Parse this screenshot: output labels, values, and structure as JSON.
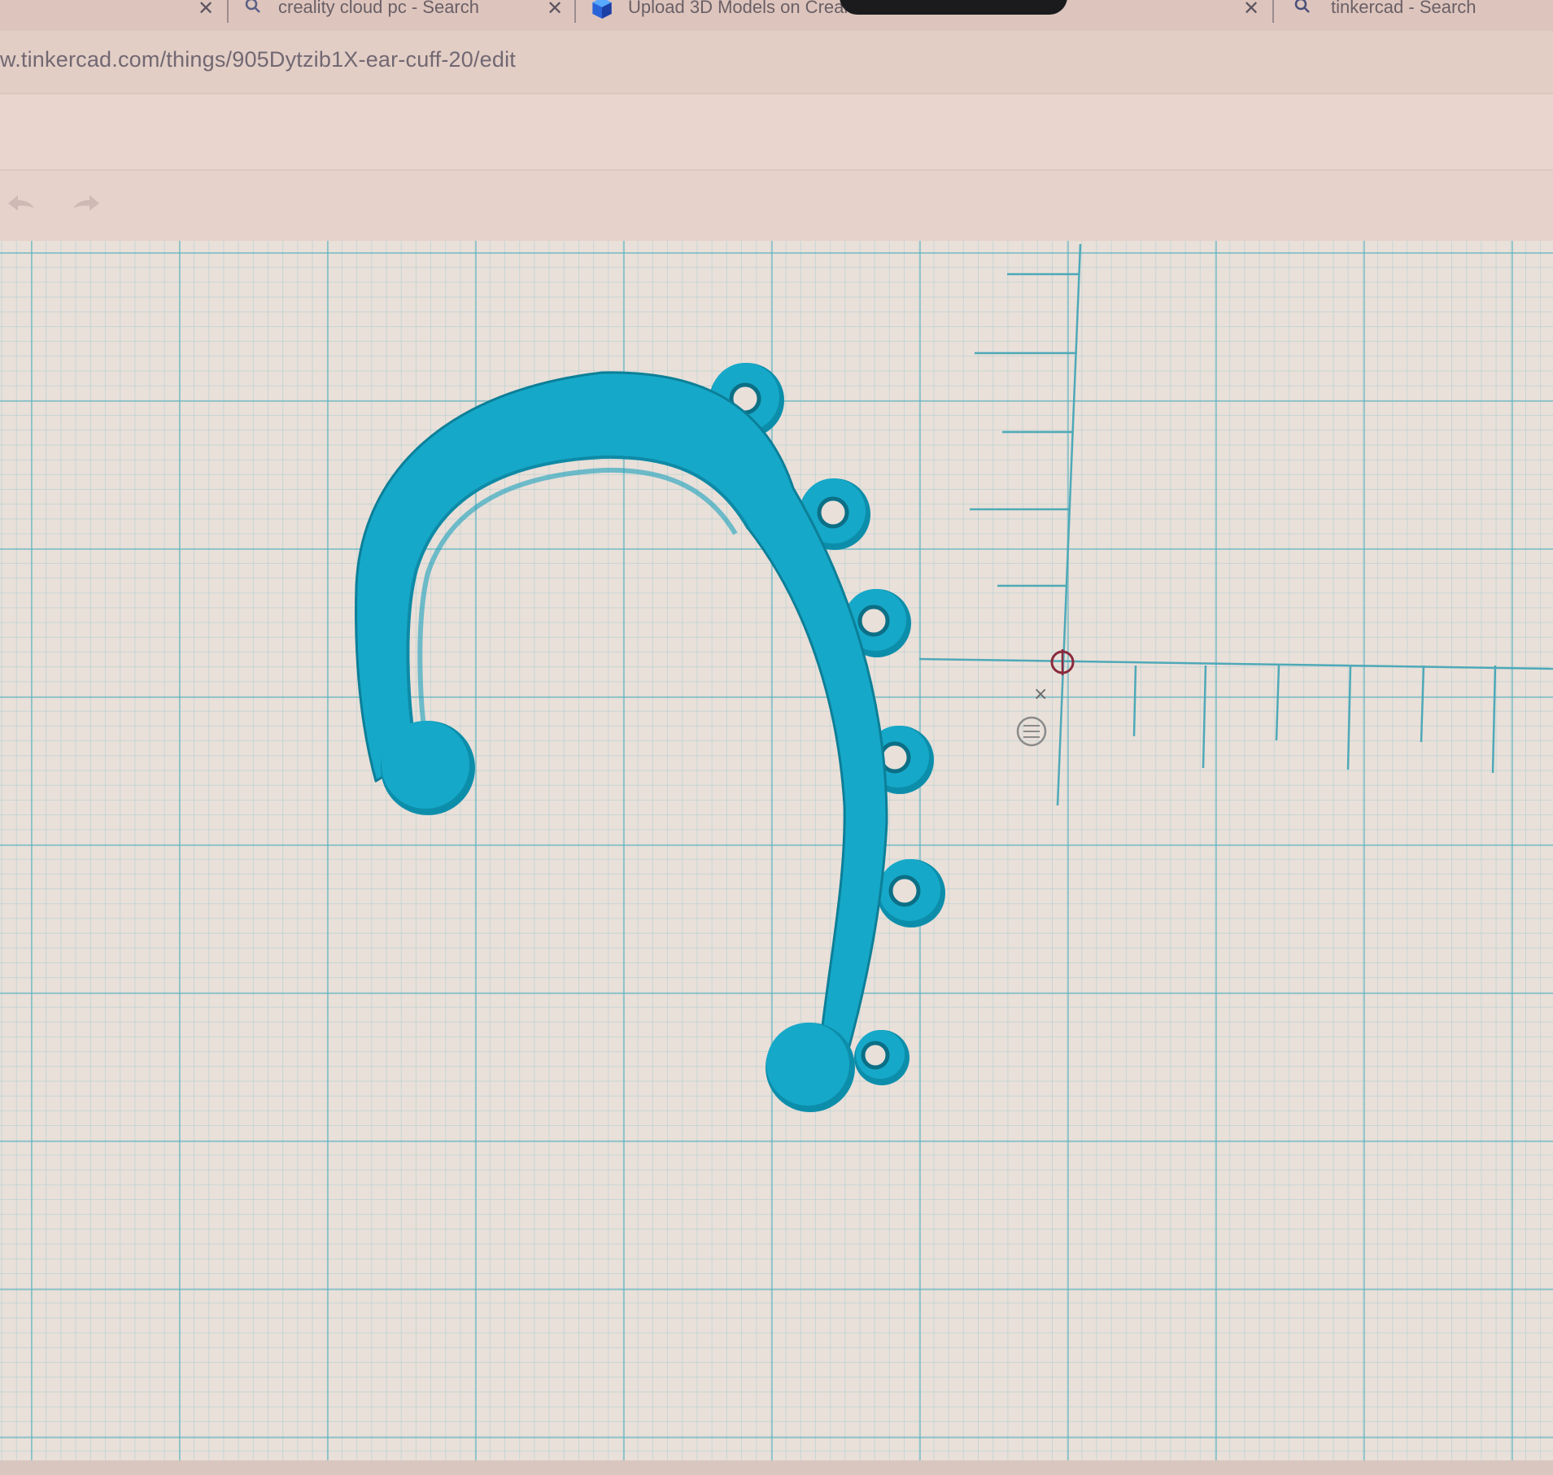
{
  "browser": {
    "tabs": [
      {
        "label": "creality cloud pc - Search",
        "icon": "search-icon"
      },
      {
        "label": "Upload 3D Models on Creal",
        "icon": "creality-cube-icon"
      },
      {
        "label": "tinkercad - Search",
        "icon": "search-icon"
      }
    ],
    "url": "w.tinkercad.com/things/905Dytzib1X-ear-cuff-20/edit"
  },
  "toolbar": {
    "undo_icon": "undo-arrow-icon",
    "redo_icon": "redo-arrow-icon"
  },
  "workplane": {
    "model_name": "ear-cuff",
    "model_color": "#16a8c8",
    "grid_color": "#56b0be",
    "close_glyph": "×"
  }
}
